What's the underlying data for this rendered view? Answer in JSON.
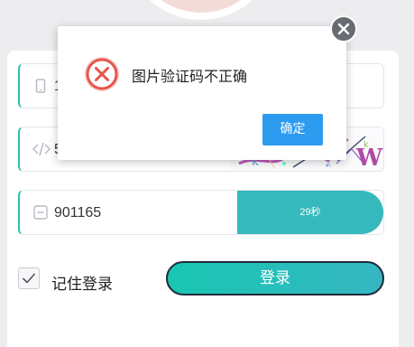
{
  "form": {
    "phone_value": "1",
    "captcha_value": "5",
    "sms_code_value": "901165",
    "countdown_label": "29秒",
    "remember_label": "记住登录",
    "remember_checked": true,
    "login_label": "登录"
  },
  "dialog": {
    "message": "图片验证码不正确",
    "confirm_label": "确定",
    "icon": "error-x-icon"
  },
  "icons": {
    "phone": "phone-icon",
    "code": "code-icon",
    "sms": "message-icon",
    "close": "close-icon",
    "check": "check-icon"
  },
  "colors": {
    "accent": "#2ec0b8",
    "button_blue": "#2d9bf0",
    "error_red": "#e8534a"
  }
}
